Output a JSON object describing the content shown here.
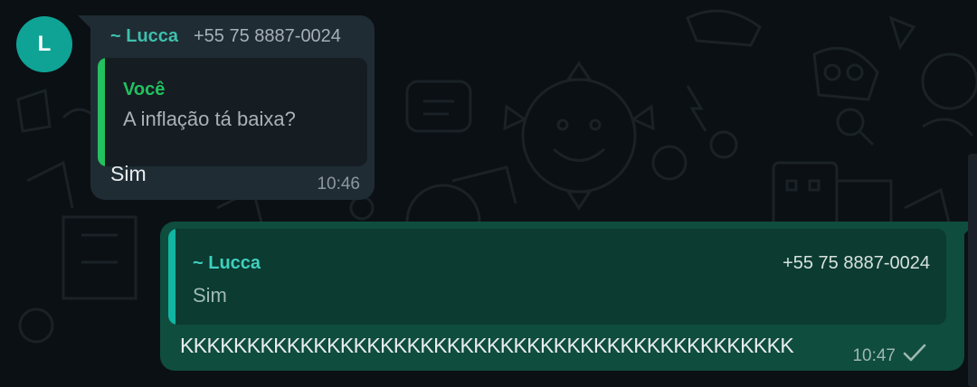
{
  "avatar": {
    "initial": "L",
    "color": "#0fa396"
  },
  "incoming_message": {
    "sender_name": "~ Lucca",
    "sender_phone": "+55 75 8887-0024",
    "quoted": {
      "author": "Você",
      "text": "A inflação tá baixa?"
    },
    "text": "Sim",
    "time": "10:46"
  },
  "outgoing_message": {
    "quoted": {
      "author": "~ Lucca",
      "phone": "+55 75 8887-0024",
      "text": "Sim"
    },
    "text": "KKKKKKKKKKKKKKKKKKKKKKKKKKKKKKKKKKKKKKKKKKKKKK",
    "time": "10:47",
    "status_icon": "single-check-icon"
  },
  "colors": {
    "background": "#0b1014",
    "incoming_bubble": "#1f2c34",
    "outgoing_bubble": "#0f4d3e",
    "sender_name": "#3fbfad",
    "quote_bar_incoming": "#23c15f",
    "quote_bar_outgoing": "#11b5a1"
  }
}
